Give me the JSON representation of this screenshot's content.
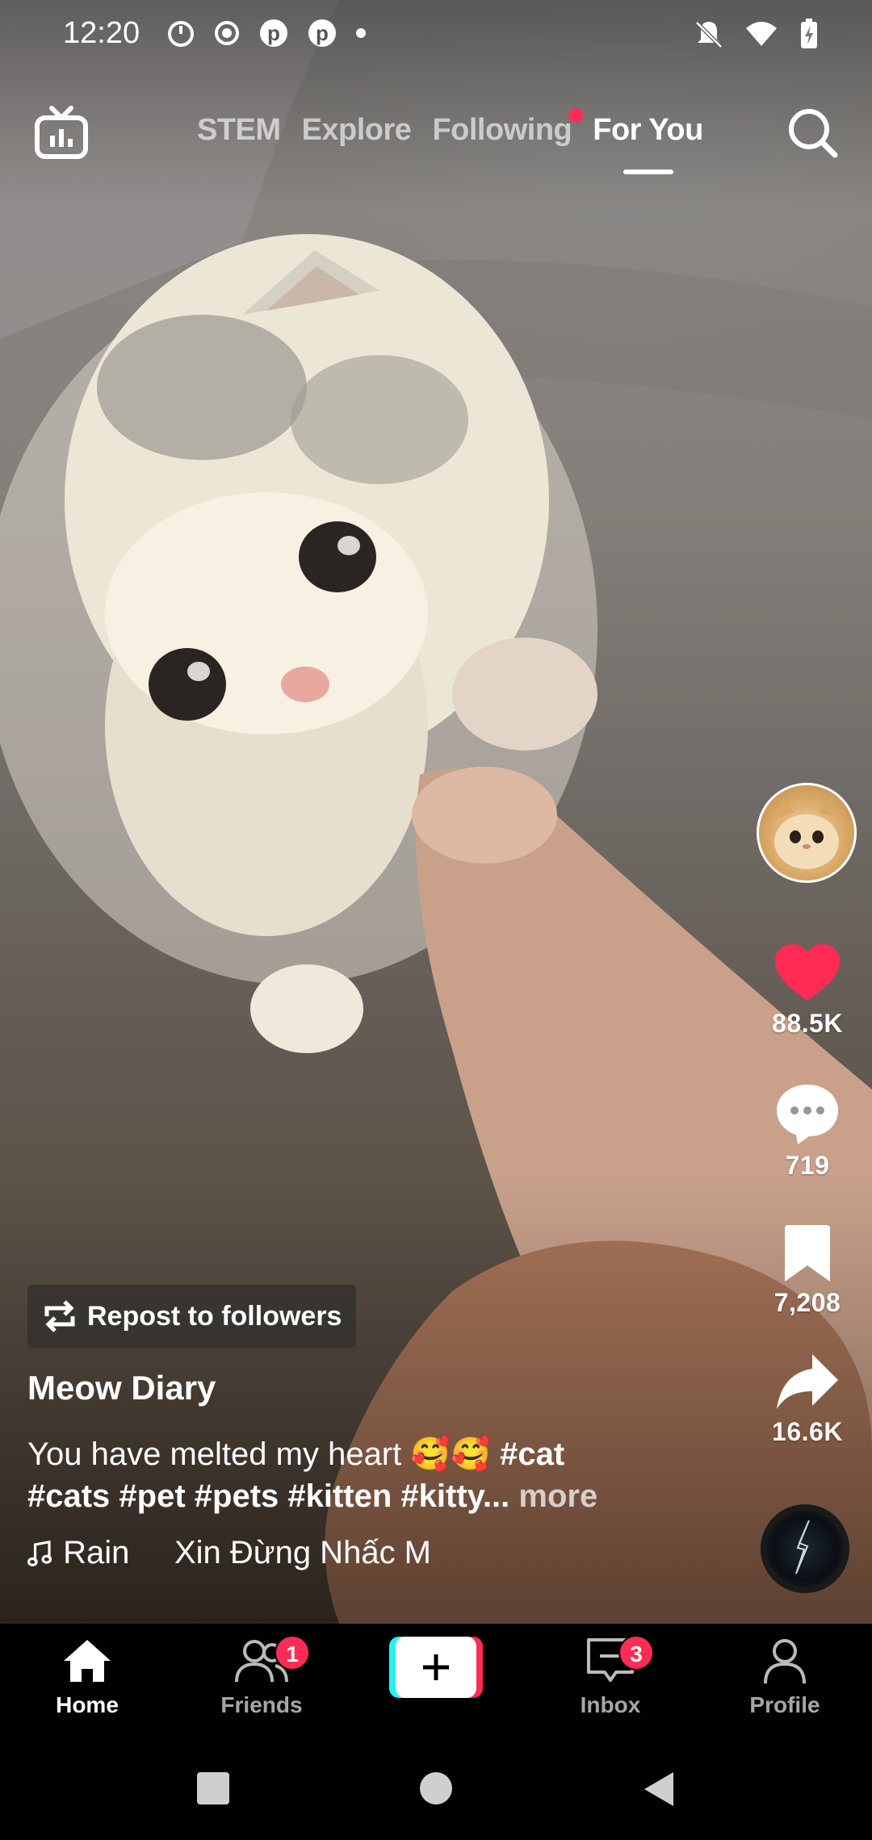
{
  "status_bar": {
    "time": "12:20",
    "left_icons": [
      "timer-icon",
      "record-icon",
      "pinterest-icon",
      "pinterest-icon",
      "dot-icon"
    ],
    "right_icons": [
      "mute-icon",
      "wifi-icon",
      "battery-charging-icon"
    ]
  },
  "top_nav": {
    "tabs": [
      {
        "label": "STEM",
        "active": false
      },
      {
        "label": "Explore",
        "active": false
      },
      {
        "label": "Following",
        "active": false,
        "has_dot": true
      },
      {
        "label": "For You",
        "active": true
      }
    ]
  },
  "actions": {
    "likes": "88.5K",
    "comments": "719",
    "saves": "7,208",
    "shares": "16.6K"
  },
  "post": {
    "repost_label": "Repost to followers",
    "author": "Meow Diary",
    "caption_text": "You have melted my heart 🥰🥰 ",
    "caption_tag_1": "#cat",
    "caption_tags_line2": "#cats #pet #pets #kitten #kitty...",
    "more_label": "more",
    "music_title": "Rain     Xin Đừng Nhấc M"
  },
  "bottom_nav": {
    "home": "Home",
    "friends": "Friends",
    "friends_badge": "1",
    "inbox": "Inbox",
    "inbox_badge": "3",
    "profile": "Profile"
  },
  "colors": {
    "accent_red": "#fe2c55",
    "accent_cyan": "#25f4ee"
  }
}
